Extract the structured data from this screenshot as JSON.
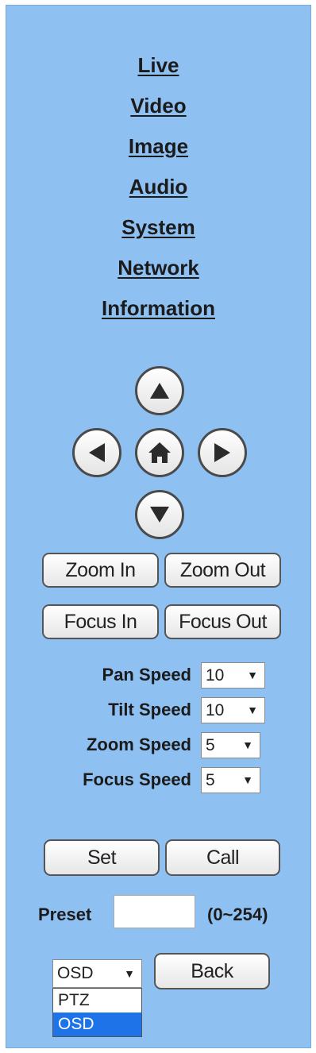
{
  "nav": {
    "items": [
      {
        "label": "Live"
      },
      {
        "label": "Video"
      },
      {
        "label": "Image"
      },
      {
        "label": "Audio"
      },
      {
        "label": "System"
      },
      {
        "label": "Network"
      },
      {
        "label": "Information"
      }
    ]
  },
  "ptz": {
    "icons": {
      "up": "arrow-up-icon",
      "down": "arrow-down-icon",
      "left": "arrow-left-icon",
      "right": "arrow-right-icon",
      "home": "home-icon"
    }
  },
  "buttons": {
    "zoom_in": "Zoom In",
    "zoom_out": "Zoom Out",
    "focus_in": "Focus In",
    "focus_out": "Focus Out",
    "set": "Set",
    "call": "Call",
    "back": "Back"
  },
  "speeds": {
    "pan": {
      "label": "Pan Speed",
      "value": "10"
    },
    "tilt": {
      "label": "Tilt Speed",
      "value": "10"
    },
    "zoom": {
      "label": "Zoom Speed",
      "value": "5"
    },
    "focus": {
      "label": "Focus Speed",
      "value": "5"
    }
  },
  "preset": {
    "label": "Preset",
    "value": "",
    "range": "(0~254)"
  },
  "mode_select": {
    "value": "OSD",
    "options": [
      {
        "label": "PTZ"
      },
      {
        "label": "OSD",
        "selected": true
      }
    ]
  },
  "colors": {
    "panel_bg": "#8fc0f2",
    "selected_option": "#1e73e8"
  }
}
